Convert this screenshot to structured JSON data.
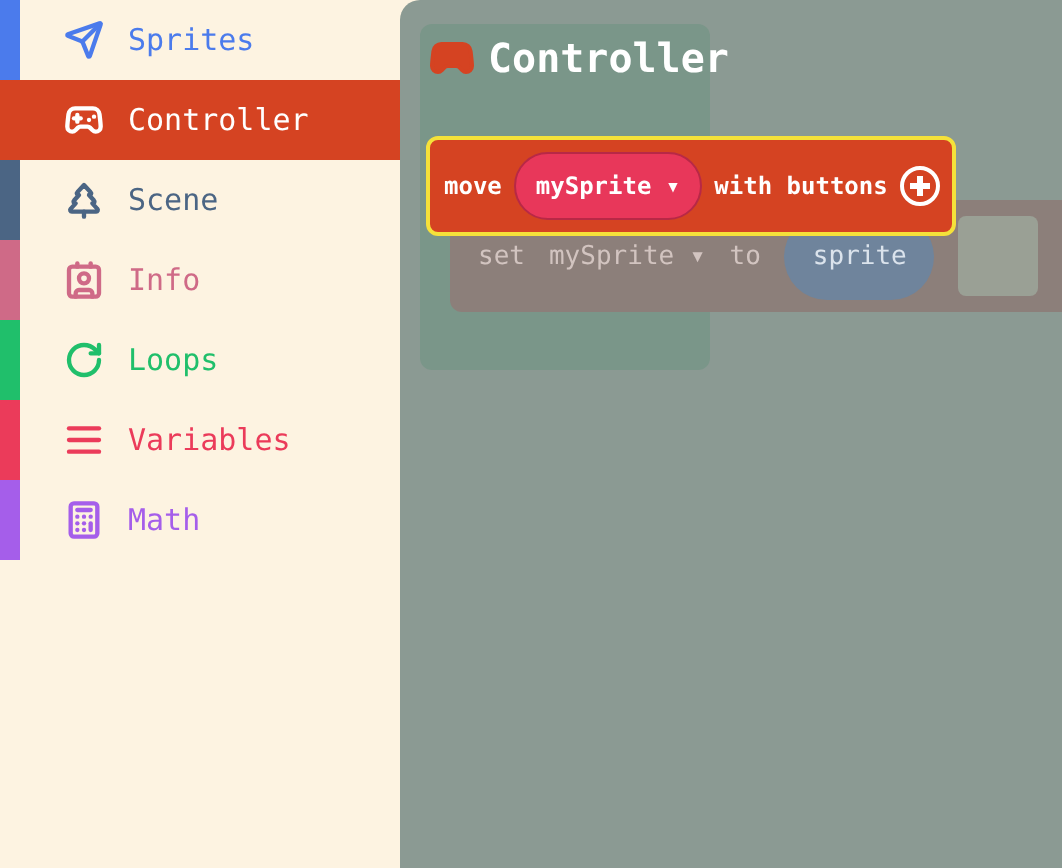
{
  "categories": [
    {
      "label": "Sprites",
      "color": "#4b7bec",
      "selected": false
    },
    {
      "label": "Controller",
      "color": "#d54322",
      "selected": true
    },
    {
      "label": "Scene",
      "color": "#4b6584",
      "selected": false
    },
    {
      "label": "Info",
      "color": "#cf6a87",
      "selected": false
    },
    {
      "label": "Loops",
      "color": "#20bf6b",
      "selected": false
    },
    {
      "label": "Variables",
      "color": "#eb3b5a",
      "selected": false
    },
    {
      "label": "Math",
      "color": "#a55eea",
      "selected": false
    }
  ],
  "flyout": {
    "heading": "Controller",
    "block": {
      "words": [
        "move",
        "with buttons"
      ],
      "dropdown": "mySprite ▾"
    },
    "background_block": {
      "words": [
        "set",
        "to"
      ],
      "dropdown": "mySprite ▾",
      "value": "sprite"
    }
  }
}
